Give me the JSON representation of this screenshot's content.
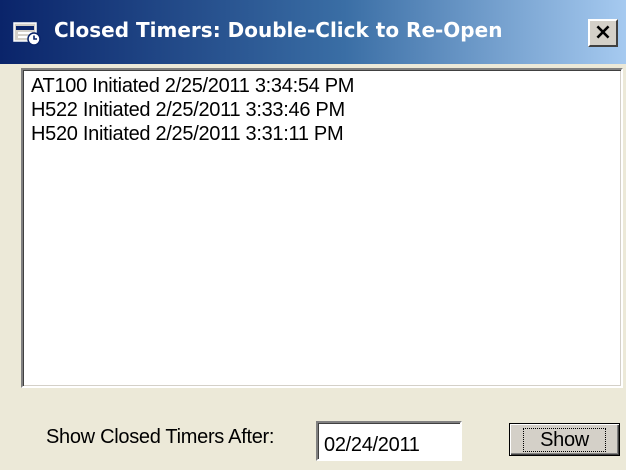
{
  "window": {
    "title": "Closed Timers: Double-Click to Re-Open",
    "close_label": "×"
  },
  "timers": {
    "items": [
      "AT100 Initiated 2/25/2011 3:34:54 PM",
      "H522 Initiated 2/25/2011 3:33:46 PM",
      "H520 Initiated 2/25/2011 3:31:11 PM"
    ]
  },
  "filter": {
    "label": "Show Closed Timers After:",
    "date_value": "02/24/2011",
    "show_button_label": "Show"
  },
  "icons": {
    "app": "timer-window-icon",
    "close": "close-icon"
  },
  "colors": {
    "titlebar_start": "#0a246a",
    "titlebar_end": "#a6caf0",
    "dialog_face": "#ece9d8"
  }
}
